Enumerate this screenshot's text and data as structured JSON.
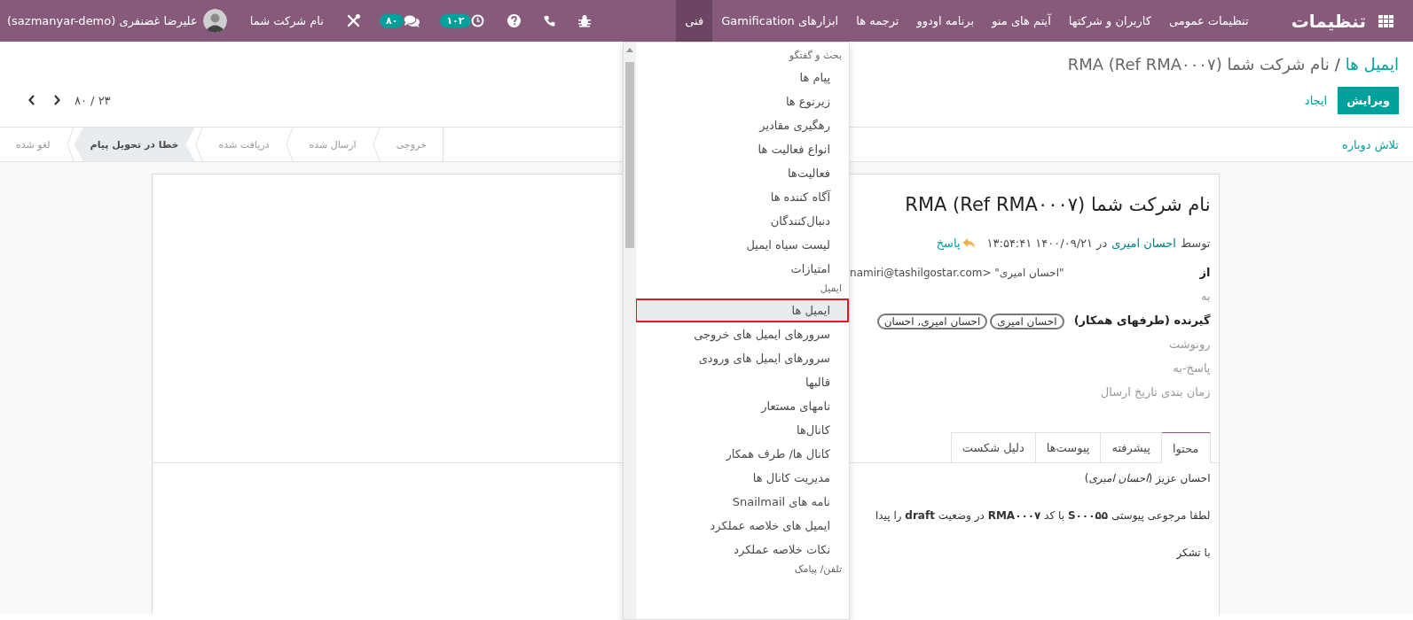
{
  "navbar": {
    "app_title": "تنظیمات",
    "menus": [
      {
        "label": "تنظیمات عمومی",
        "selected": false
      },
      {
        "label": "کاربران و شرکتها",
        "selected": false
      },
      {
        "label": "آیتم های منو",
        "selected": false
      },
      {
        "label": "برنامه اودوو",
        "selected": false
      },
      {
        "label": "ترجمه ها",
        "selected": false
      },
      {
        "label": "ابزارهای Gamification",
        "selected": false
      },
      {
        "label": "فنی",
        "selected": true
      }
    ],
    "activity_count": "۱۰۲",
    "message_count": "۸۰",
    "company": "نام شرکت شما",
    "user": "علیرضا غضنفری (sazmanyar-demo)"
  },
  "breadcrumb_separator": "/",
  "breadcrumb": [
    {
      "label": "ایمیل ها"
    },
    {
      "label": "RMA (Ref RMA۰۰۰۷) نام شرکت شما"
    }
  ],
  "buttons": [
    {
      "kind": "primary",
      "label": "ویرایش"
    },
    {
      "kind": "link",
      "label": "ایجاد"
    }
  ],
  "pager": "۲۳ / ۸۰",
  "header_buttons": [
    "تلاش دوباره"
  ],
  "statusbar": [
    {
      "label": "خروجی",
      "selected": false
    },
    {
      "label": "ارسال شده",
      "selected": false
    },
    {
      "label": "دریافت شده",
      "selected": false
    },
    {
      "label": "خطا در تحویل پیام",
      "selected": true
    },
    {
      "label": "لغو شده",
      "selected": false
    }
  ],
  "record": {
    "title": "RMA (Ref RMA۰۰۰۷) نام شرکت شما",
    "author_prefix": "توسط",
    "author": "احسان امیری",
    "date": "در ۱۴۰۰/۰۹/۲۱ ۱۳:۵۴:۴۱",
    "reply": "پاسخ",
    "fields": [
      {
        "label": "از",
        "value": "\"احسان امیری\" <namiri@tashilgostar.com"
      },
      {
        "label": "به"
      },
      {
        "label": "گیرنده (طرفهای همکار)",
        "tags": [
          "احسان امیری",
          "احسان امیری, احسان"
        ]
      },
      {
        "label": "رونوشت"
      },
      {
        "label": "پاسخ-به"
      },
      {
        "label": "زمان بندی تاریخ ارسال"
      }
    ],
    "tabs": [
      {
        "label": "محتوا",
        "selected": true
      },
      {
        "label": "پیشرفته",
        "selected": false
      },
      {
        "label": "پیوست‌ها",
        "selected": false
      },
      {
        "label": "دلیل شکست",
        "selected": false
      }
    ],
    "body": [
      "احسان عزیز (*احسان امیری*)",
      "لطفا مرجوعی پیوستی **S۰۰۰۵۵** با کد **RMA۰۰۰۷** در وضعیت **draft** را پیدا",
      "با تشکر"
    ]
  },
  "dropdown": [
    {
      "kind": "header",
      "label": "بحث و گفتگو",
      "selected": false
    },
    {
      "kind": "item",
      "label": "پیام ها",
      "selected": false
    },
    {
      "kind": "item",
      "label": "زیرنوع ها",
      "selected": false
    },
    {
      "kind": "item",
      "label": "رهگیری مقادیر",
      "selected": false
    },
    {
      "kind": "item",
      "label": "انواع فعالیت ها",
      "selected": false
    },
    {
      "kind": "item",
      "label": "فعالیت‌ها",
      "selected": false
    },
    {
      "kind": "item",
      "label": "آگاه کننده ها",
      "selected": false
    },
    {
      "kind": "item",
      "label": "دنبال‌کنندگان",
      "selected": false
    },
    {
      "kind": "item",
      "label": "لیست سیاه ایمیل",
      "selected": false
    },
    {
      "kind": "item",
      "label": "امتیازات",
      "selected": false
    },
    {
      "kind": "header",
      "label": "ایمیل",
      "selected": false
    },
    {
      "kind": "item",
      "label": "ایمیل ها",
      "selected": true
    },
    {
      "kind": "item",
      "label": "سرورهای ایمیل های خروجی",
      "selected": false
    },
    {
      "kind": "item",
      "label": "سرورهای ایمیل های ورودی",
      "selected": false
    },
    {
      "kind": "item",
      "label": "قالبها",
      "selected": false
    },
    {
      "kind": "item",
      "label": "نامهای مستعار",
      "selected": false
    },
    {
      "kind": "item",
      "label": "کانال‌ها",
      "selected": false
    },
    {
      "kind": "item",
      "label": "کانال ها/ طرف همکار",
      "selected": false
    },
    {
      "kind": "item",
      "label": "مدیریت کانال ها",
      "selected": false
    },
    {
      "kind": "item",
      "label": "نامه های Snailmail",
      "selected": false
    },
    {
      "kind": "item",
      "label": "ایمیل های خلاصه عملکرد",
      "selected": false
    },
    {
      "kind": "item",
      "label": "نکات خلاصه عملکرد",
      "selected": false
    },
    {
      "kind": "header",
      "label": "تلفن/ پیامک",
      "selected": false
    }
  ]
}
